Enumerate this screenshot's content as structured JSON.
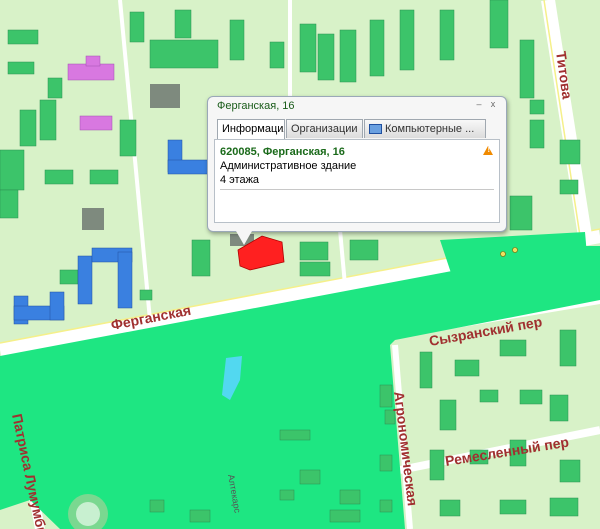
{
  "streets": {
    "fergana": "Ферганская",
    "titova": "Титова",
    "syzransky": "Сызранский пер",
    "remeslenny": "Ремесленный пер",
    "agronomicheskaya": "Агрономическая",
    "patrisa": "Патриса Лумумбы",
    "small_side": "Алтекарс"
  },
  "popup": {
    "title": "Ферганская, 16",
    "tabs": [
      "Информация",
      "Организации",
      "Компьютерные ..."
    ],
    "address": "620085, Ферганская, 16",
    "line1": "Административное здание",
    "line2": "4 этажа",
    "ctrl_min": "–",
    "ctrl_close": "x"
  },
  "colors": {
    "park": "#1ee682",
    "building": "#3cc46a",
    "highlight": "#ff2020",
    "blue_building": "#3a80e0",
    "violet_building": "#d878e0",
    "street_label": "#a03030"
  }
}
